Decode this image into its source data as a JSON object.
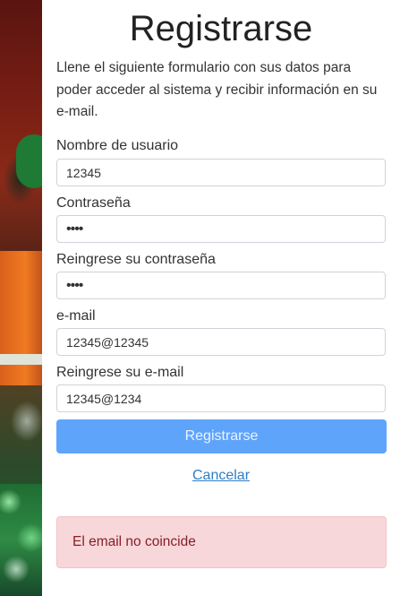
{
  "page": {
    "title": "Registrarse",
    "intro": "Llene el siguiente formulario con sus datos para poder acceder al sistema y recibir información en su e-mail."
  },
  "form": {
    "username": {
      "label": "Nombre de usuario",
      "value": "12345"
    },
    "password": {
      "label": "Contraseña",
      "value": "••••"
    },
    "password_confirm": {
      "label": "Reingrese su contraseña",
      "value": "••••"
    },
    "email": {
      "label": "e-mail",
      "value": "12345@12345"
    },
    "email_confirm": {
      "label": "Reingrese su e-mail",
      "value": "12345@1234"
    },
    "submit_label": "Registrarse",
    "cancel_label": "Cancelar"
  },
  "alert": {
    "message": "El email no coincide",
    "type": "danger"
  },
  "colors": {
    "primary_button": "#5fa4fb",
    "alert_bg": "#f8d7da",
    "alert_text": "#842029",
    "link": "#2f7ec6"
  }
}
